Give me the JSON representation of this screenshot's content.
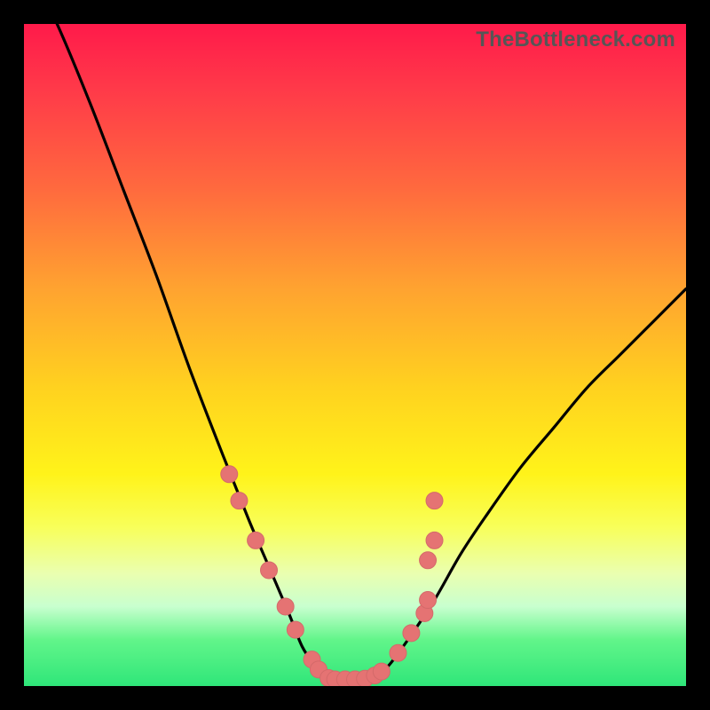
{
  "watermark": "TheBottleneck.com",
  "colors": {
    "frame": "#000000",
    "curve": "#000000",
    "dot_fill": "#e57373",
    "dot_stroke": "#d46a6a",
    "gradient_top": "#ff1a4a",
    "gradient_bottom": "#2fe679"
  },
  "chart_data": {
    "type": "line",
    "title": "",
    "xlabel": "",
    "ylabel": "",
    "xlim": [
      0,
      100
    ],
    "ylim": [
      0,
      100
    ],
    "x": [
      0,
      5,
      10,
      15,
      20,
      25,
      30,
      34,
      37,
      40,
      42,
      44,
      45,
      46,
      47,
      48,
      50,
      52,
      53,
      55,
      58,
      62,
      66,
      70,
      75,
      80,
      85,
      90,
      95,
      100
    ],
    "series": [
      {
        "name": "bottleneck-curve",
        "values": [
          110,
          100,
          88,
          75,
          62,
          48,
          35,
          25,
          18,
          11,
          6,
          3,
          2,
          1.2,
          1,
          1,
          1,
          1.2,
          1.6,
          3,
          7,
          13,
          20,
          26,
          33,
          39,
          45,
          50,
          55,
          60
        ]
      }
    ],
    "scatter_points": [
      {
        "x": 31,
        "y": 32
      },
      {
        "x": 32.5,
        "y": 28
      },
      {
        "x": 35,
        "y": 22
      },
      {
        "x": 37,
        "y": 17.5
      },
      {
        "x": 39.5,
        "y": 12
      },
      {
        "x": 41,
        "y": 8.5
      },
      {
        "x": 43.5,
        "y": 4
      },
      {
        "x": 44.5,
        "y": 2.5
      },
      {
        "x": 46,
        "y": 1.2
      },
      {
        "x": 47,
        "y": 1
      },
      {
        "x": 48.5,
        "y": 1
      },
      {
        "x": 50,
        "y": 1
      },
      {
        "x": 51.5,
        "y": 1.1
      },
      {
        "x": 53,
        "y": 1.6
      },
      {
        "x": 54,
        "y": 2.2
      },
      {
        "x": 56.5,
        "y": 5
      },
      {
        "x": 58.5,
        "y": 8
      },
      {
        "x": 60.5,
        "y": 11
      },
      {
        "x": 61,
        "y": 13
      },
      {
        "x": 61,
        "y": 19
      },
      {
        "x": 62,
        "y": 22
      },
      {
        "x": 62,
        "y": 28
      }
    ]
  }
}
